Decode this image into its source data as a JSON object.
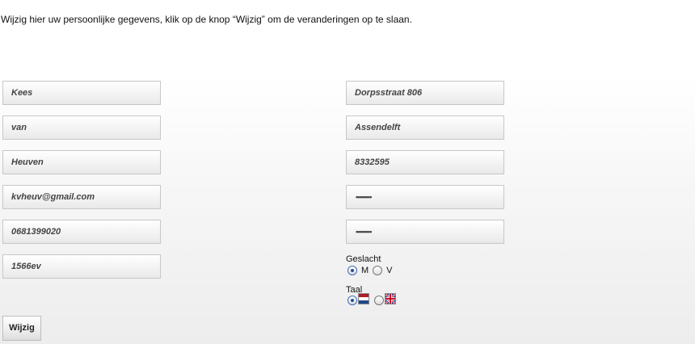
{
  "intro_text": "Wijzig hier uw persoonlijke gegevens, klik op de knop “Wijzig” om de veranderingen op te slaan.",
  "left_fields": {
    "first_name": "Kees",
    "prefix": "van",
    "last_name": "Heuven",
    "email": "kvheuv@gmail.com",
    "phone": "0681399020",
    "postcode": "1566ev"
  },
  "right_fields": {
    "street": "Dorpsstraat 806",
    "city": "Assendelft",
    "number": "8332595",
    "password_mask": "•••••••••",
    "password_confirm_mask": "•••••••••"
  },
  "gender": {
    "label": "Geslacht",
    "options": [
      "M",
      "V"
    ],
    "selected": "M"
  },
  "language": {
    "label": "Taal",
    "options": [
      "dutch-flag-icon",
      "uk-flag-icon"
    ],
    "selected": "dutch-flag-icon"
  },
  "submit_label": "Wijzig"
}
